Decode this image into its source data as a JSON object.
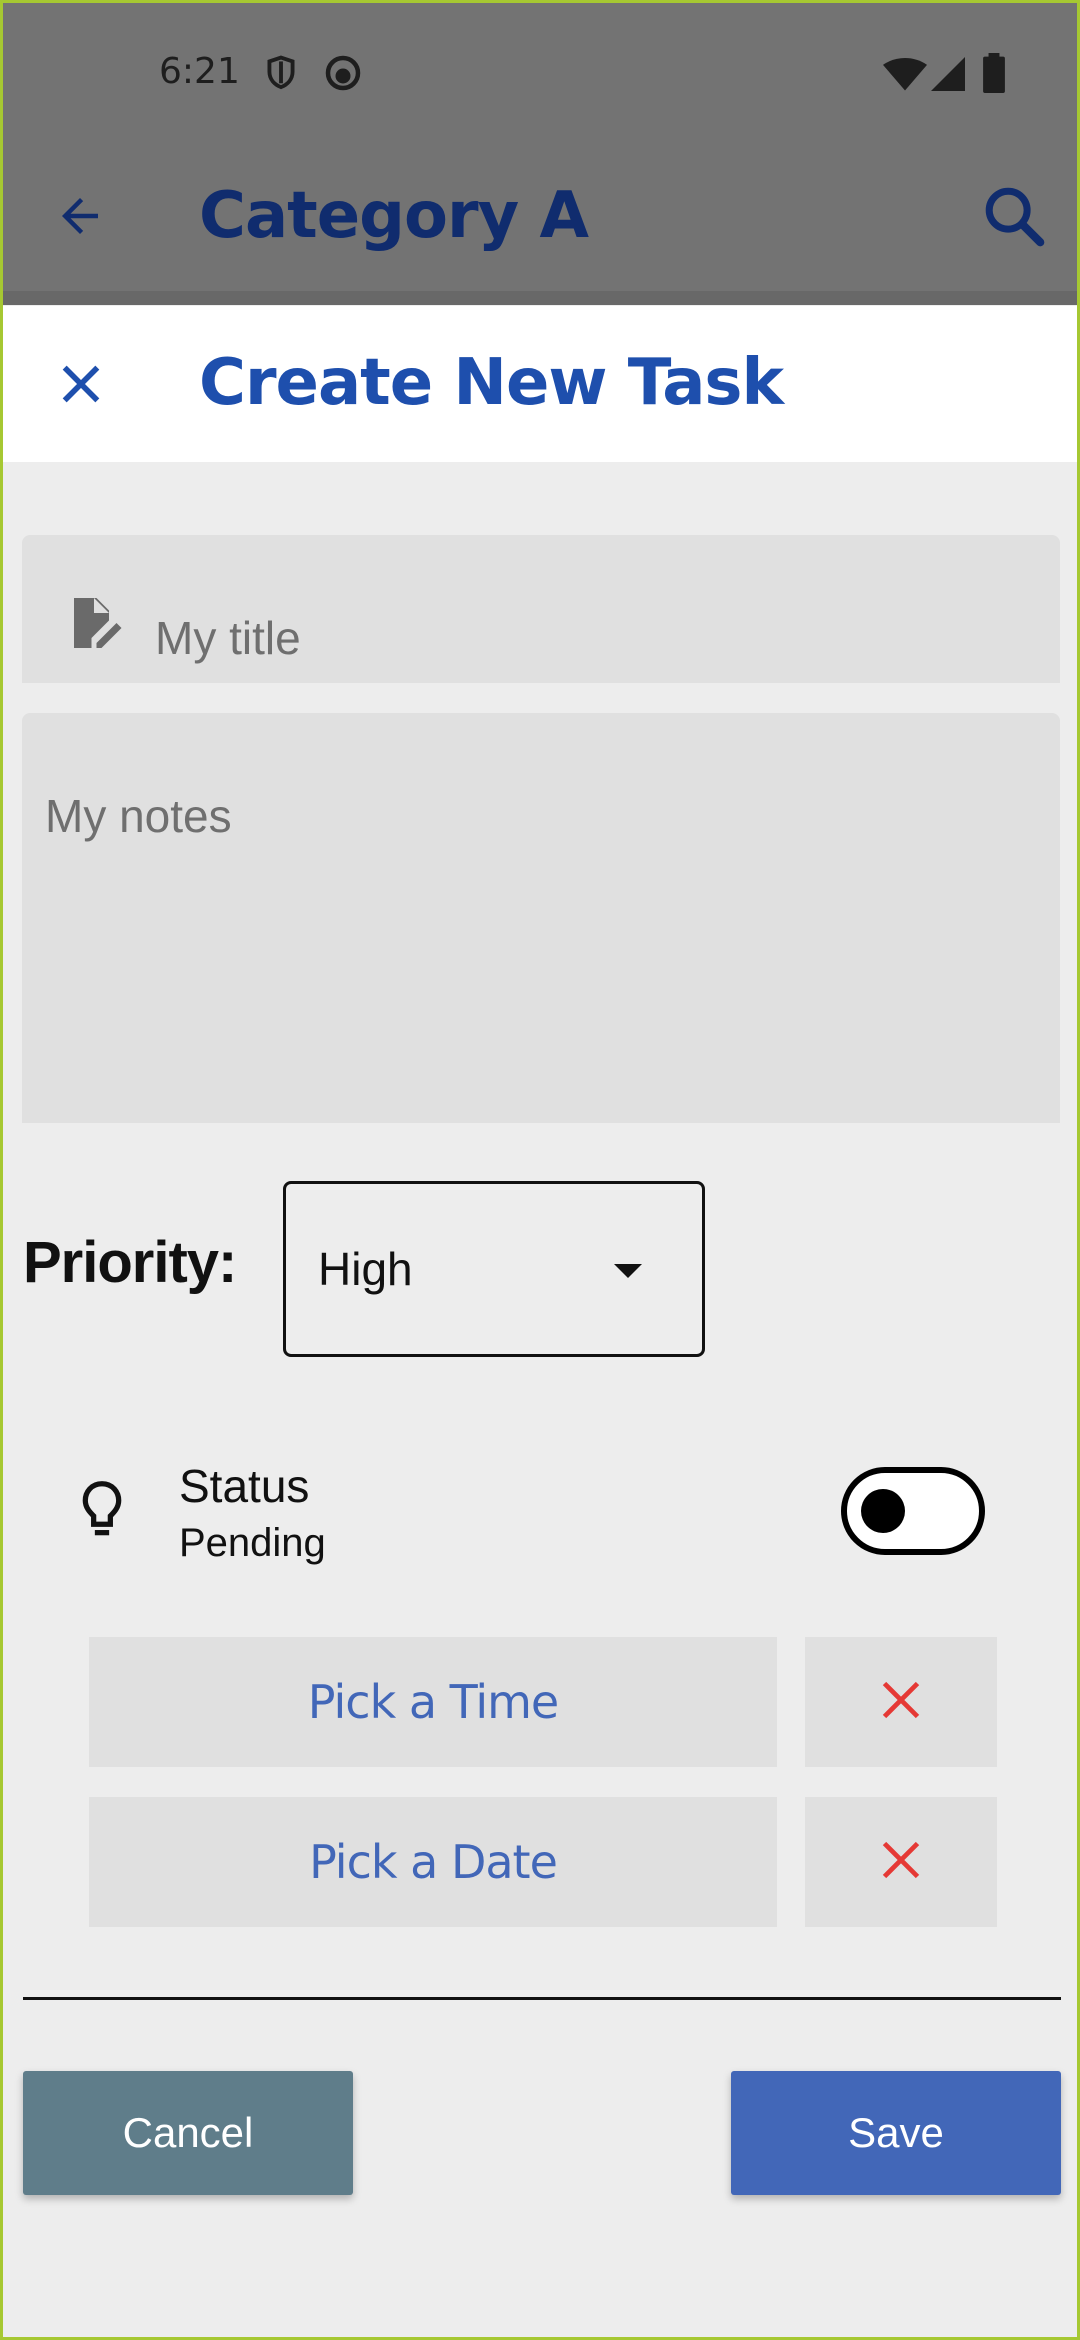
{
  "status_bar": {
    "time": "6:21",
    "icons": [
      "shield-icon",
      "face-icon",
      "wifi-icon",
      "signal-icon",
      "battery-icon"
    ]
  },
  "appbar": {
    "title": "Category A",
    "back_icon": "arrow-left-icon",
    "search_icon": "search-icon"
  },
  "sheet": {
    "title": "Create New Task",
    "close_icon": "close-icon"
  },
  "form": {
    "title_placeholder": "My title",
    "title_icon": "edit-document-icon",
    "notes_placeholder": "My notes",
    "priority_label": "Priority:",
    "priority_value": "High",
    "status_title": "Status",
    "status_value": "Pending",
    "status_toggle_on": false,
    "pick_time_label": "Pick a Time",
    "pick_date_label": "Pick a Date"
  },
  "actions": {
    "cancel_label": "Cancel",
    "save_label": "Save"
  },
  "colors": {
    "primary": "#4267b8",
    "title_blue": "#1e4fad",
    "cancel": "#5f7d8a",
    "clear_red": "#e53935",
    "background": "#ededed",
    "field": "#e0e0e0"
  }
}
